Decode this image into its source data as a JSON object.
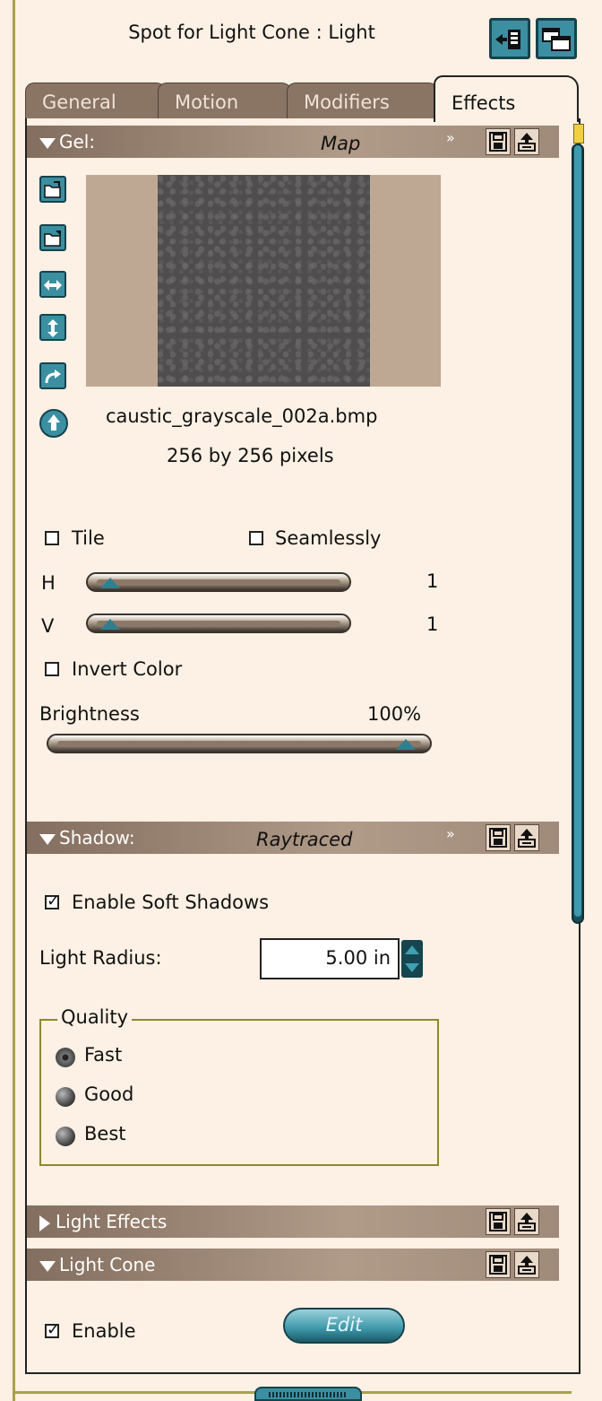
{
  "window": {
    "title": "Spot for Light Cone : Light"
  },
  "tabs": [
    {
      "label": "General"
    },
    {
      "label": "Motion"
    },
    {
      "label": "Modifiers"
    },
    {
      "label": "Effects"
    }
  ],
  "gel": {
    "label": "Gel:",
    "mode": "Map",
    "filename": "caustic_grayscale_002a.bmp",
    "dimensions": "256 by 256 pixels",
    "tile_label": "Tile",
    "seamlessly_label": "Seamlessly",
    "h_label": "H",
    "h_value": "1",
    "v_label": "V",
    "v_value": "1",
    "invert_label": "Invert Color",
    "brightness_label": "Brightness",
    "brightness_value": "100%"
  },
  "shadow": {
    "label": "Shadow:",
    "mode": "Raytraced",
    "soft_shadows_label": "Enable Soft Shadows",
    "light_radius_label": "Light Radius:",
    "light_radius_value": "5.00 in",
    "quality_label": "Quality",
    "quality_options": [
      "Fast",
      "Good",
      "Best"
    ],
    "quality_selected": "Fast"
  },
  "light_effects": {
    "label": "Light Effects"
  },
  "light_cone": {
    "label": "Light Cone",
    "enable_label": "Enable",
    "edit_label": "Edit"
  }
}
